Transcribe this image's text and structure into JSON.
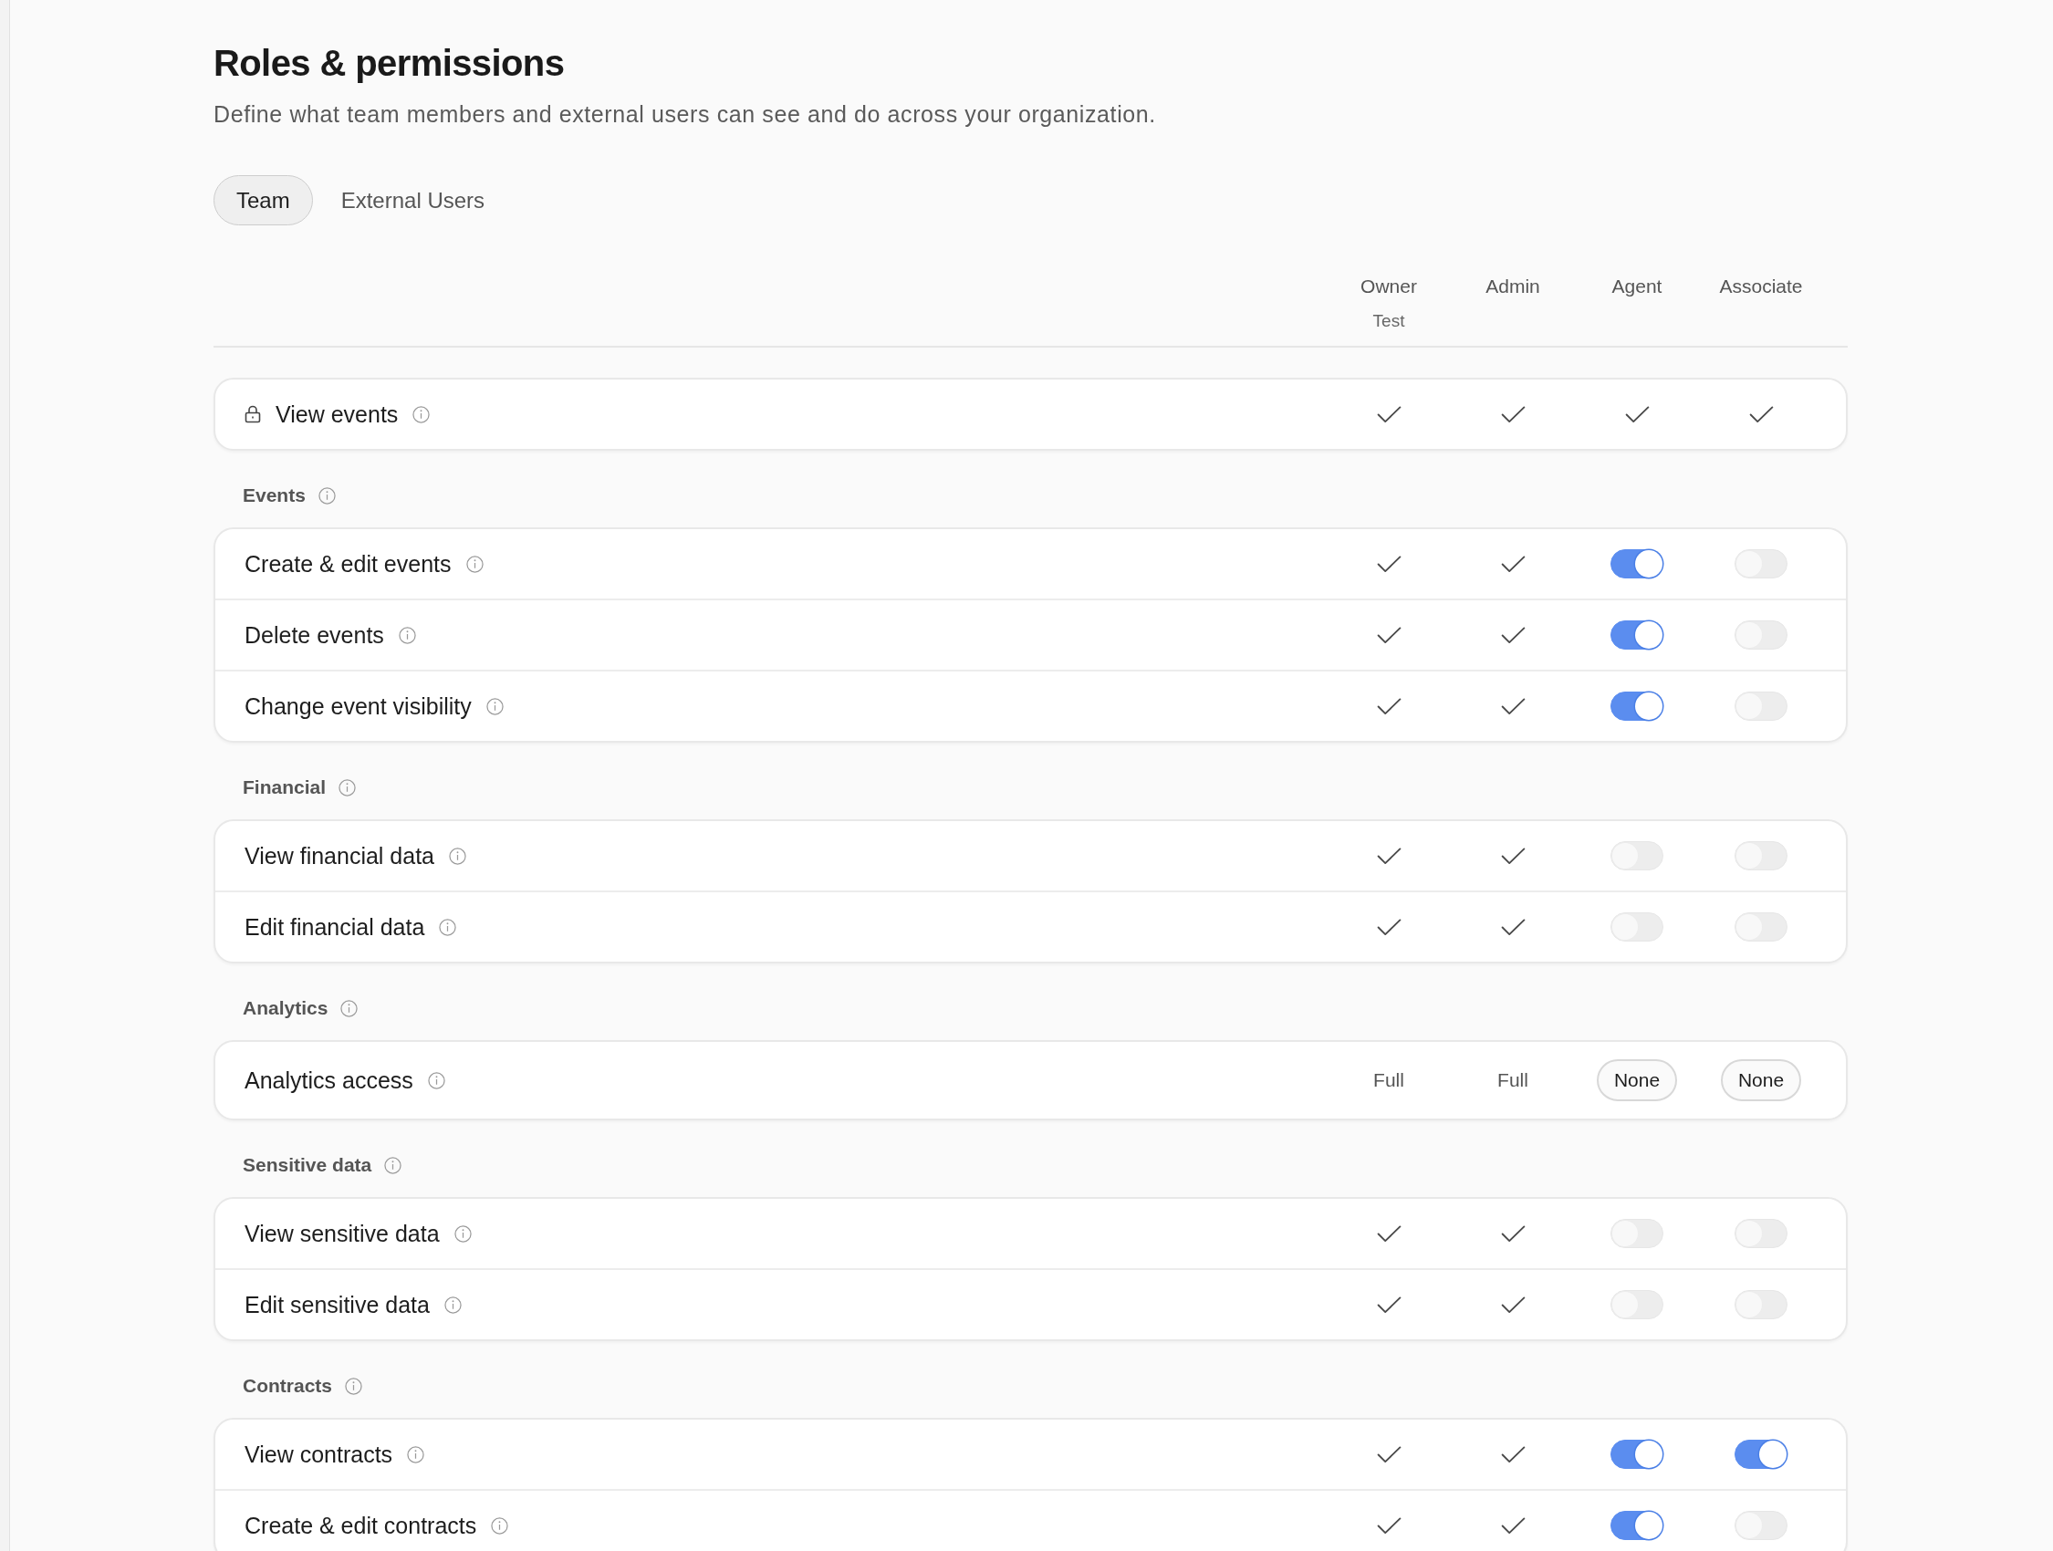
{
  "header": {
    "title": "Roles & permissions",
    "subtitle": "Define what team members and external users can see and do across your organization."
  },
  "tabs": [
    {
      "label": "Team",
      "selected": true
    },
    {
      "label": "External Users",
      "selected": false
    }
  ],
  "columns": [
    {
      "name": "Owner",
      "note": "Test"
    },
    {
      "name": "Admin"
    },
    {
      "name": "Agent"
    },
    {
      "name": "Associate"
    }
  ],
  "base_row": {
    "label": "View events",
    "locked": true,
    "cells": [
      {
        "kind": "check"
      },
      {
        "kind": "check"
      },
      {
        "kind": "check"
      },
      {
        "kind": "check"
      }
    ]
  },
  "sections": [
    {
      "title": "Events",
      "rows": [
        {
          "label": "Create & edit events",
          "cells": [
            {
              "kind": "check"
            },
            {
              "kind": "check"
            },
            {
              "kind": "toggle",
              "on": true
            },
            {
              "kind": "toggle",
              "on": false
            }
          ]
        },
        {
          "label": "Delete events",
          "cells": [
            {
              "kind": "check"
            },
            {
              "kind": "check"
            },
            {
              "kind": "toggle",
              "on": true
            },
            {
              "kind": "toggle",
              "on": false
            }
          ]
        },
        {
          "label": "Change event visibility",
          "cells": [
            {
              "kind": "check"
            },
            {
              "kind": "check"
            },
            {
              "kind": "toggle",
              "on": true
            },
            {
              "kind": "toggle",
              "on": false
            }
          ]
        }
      ]
    },
    {
      "title": "Financial",
      "rows": [
        {
          "label": "View financial data",
          "cells": [
            {
              "kind": "check"
            },
            {
              "kind": "check"
            },
            {
              "kind": "toggle",
              "on": false
            },
            {
              "kind": "toggle",
              "on": false
            }
          ]
        },
        {
          "label": "Edit financial data",
          "cells": [
            {
              "kind": "check"
            },
            {
              "kind": "check"
            },
            {
              "kind": "toggle",
              "on": false
            },
            {
              "kind": "toggle",
              "on": false
            }
          ]
        }
      ]
    },
    {
      "title": "Analytics",
      "rows": [
        {
          "label": "Analytics access",
          "cells": [
            {
              "kind": "value",
              "text": "Full"
            },
            {
              "kind": "value",
              "text": "Full"
            },
            {
              "kind": "select",
              "text": "None"
            },
            {
              "kind": "select",
              "text": "None"
            }
          ]
        }
      ]
    },
    {
      "title": "Sensitive data",
      "rows": [
        {
          "label": "View sensitive data",
          "cells": [
            {
              "kind": "check"
            },
            {
              "kind": "check"
            },
            {
              "kind": "toggle",
              "on": false
            },
            {
              "kind": "toggle",
              "on": false
            }
          ]
        },
        {
          "label": "Edit sensitive data",
          "cells": [
            {
              "kind": "check"
            },
            {
              "kind": "check"
            },
            {
              "kind": "toggle",
              "on": false
            },
            {
              "kind": "toggle",
              "on": false
            }
          ]
        }
      ]
    },
    {
      "title": "Contracts",
      "rows": [
        {
          "label": "View contracts",
          "cells": [
            {
              "kind": "check"
            },
            {
              "kind": "check"
            },
            {
              "kind": "toggle",
              "on": true
            },
            {
              "kind": "toggle",
              "on": true
            }
          ]
        },
        {
          "label": "Create & edit contracts",
          "cells": [
            {
              "kind": "check"
            },
            {
              "kind": "check"
            },
            {
              "kind": "toggle",
              "on": true
            },
            {
              "kind": "toggle",
              "on": false
            }
          ]
        }
      ]
    }
  ]
}
